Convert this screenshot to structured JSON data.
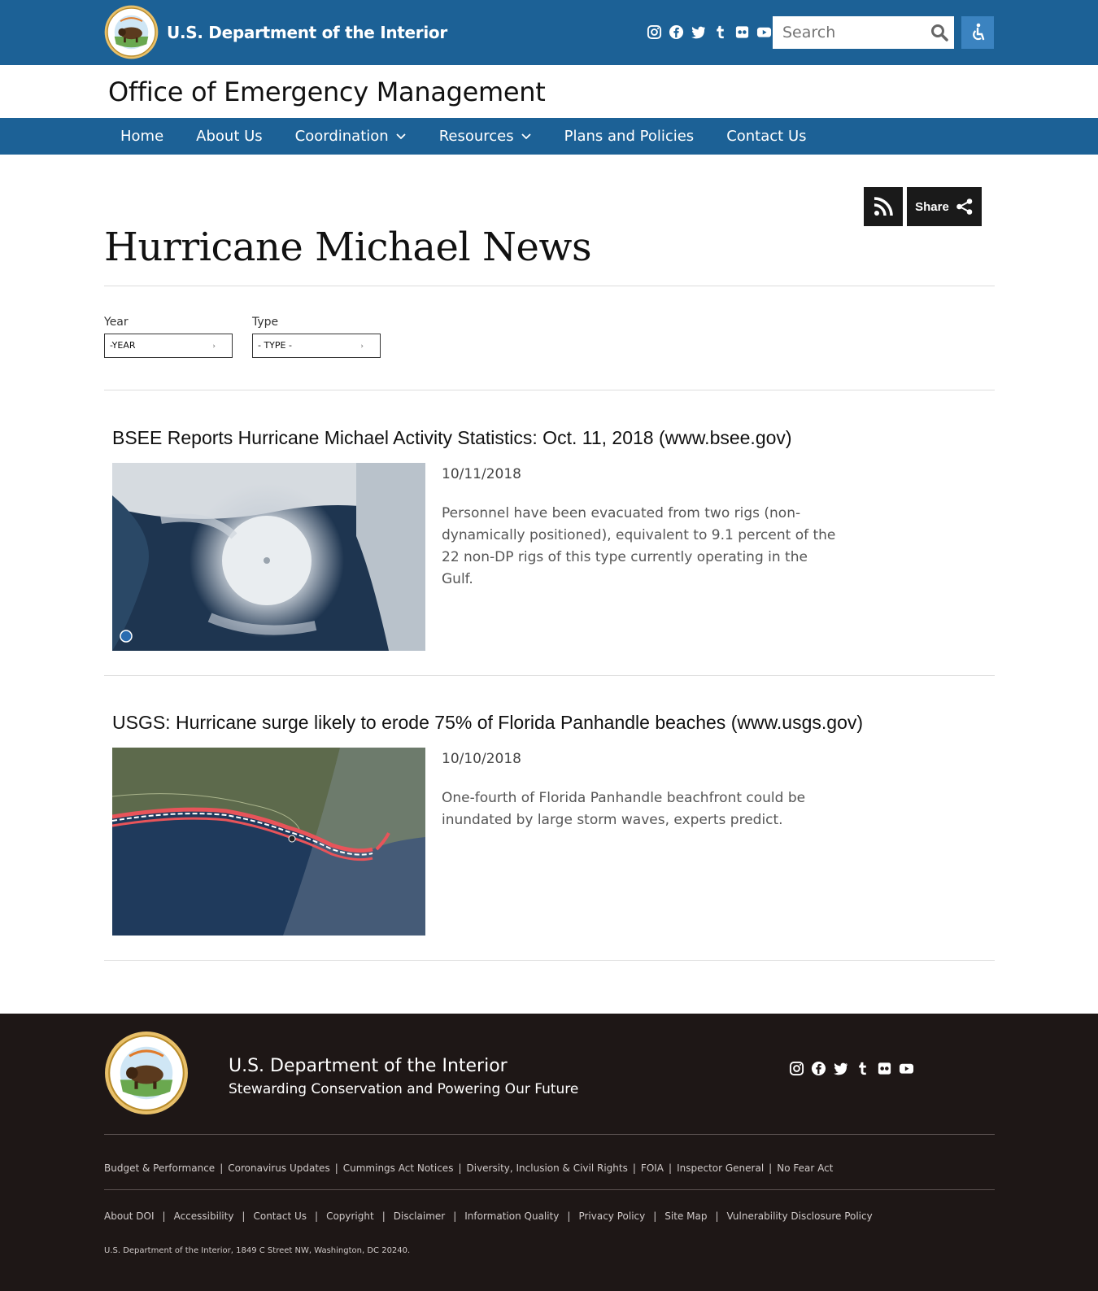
{
  "header": {
    "agency_name": "U.S. Department of the Interior",
    "search_placeholder": "Search",
    "social_icons": [
      "instagram-icon",
      "facebook-icon",
      "twitter-icon",
      "tumblr-icon",
      "flickr-icon",
      "youtube-icon"
    ],
    "colors": {
      "topbar": "#1c6196",
      "accessibility_button": "#3b83c0"
    }
  },
  "office": {
    "title": "Office of Emergency Management"
  },
  "nav": {
    "items": [
      {
        "label": "Home"
      },
      {
        "label": "About Us"
      },
      {
        "label": "Coordination"
      },
      {
        "label": "Resources"
      },
      {
        "label": "Plans and Policies"
      },
      {
        "label": "Contact Us"
      }
    ]
  },
  "actions": {
    "share_label": "Share"
  },
  "page": {
    "title": "Hurricane Michael News"
  },
  "filters": {
    "year_label": "Year",
    "year_value": "-YEAR",
    "type_label": "Type",
    "type_value": "- TYPE -"
  },
  "news": [
    {
      "title": "BSEE Reports Hurricane Michael Activity Statistics: Oct. 11, 2018 (www.bsee.gov)",
      "date": "10/11/2018",
      "summary": "Personnel have been evacuated from two rigs (non-dynamically positioned), equivalent to 9.1 percent of the 22 non-DP rigs of this type currently operating in the Gulf."
    },
    {
      "title": "USGS: Hurricane surge likely to erode 75% of Florida Panhandle beaches (www.usgs.gov)",
      "date": "10/10/2018",
      "summary": "One-fourth of Florida Panhandle beachfront could be inundated by large storm waves, experts predict."
    }
  ],
  "footer": {
    "name": "U.S. Department of the Interior",
    "tagline": "Stewarding Conservation and Powering Our Future",
    "links_row1": [
      "Budget & Performance",
      "Coronavirus Updates",
      "Cummings Act Notices",
      "Diversity, Inclusion & Civil Rights",
      "FOIA",
      "Inspector General",
      "No Fear Act"
    ],
    "links_row2": [
      "About DOI",
      "Accessibility",
      "Contact Us",
      "Copyright",
      "Disclaimer",
      "Information Quality",
      "Privacy Policy",
      "Site Map",
      "Vulnerability Disclosure Policy"
    ],
    "address": "U.S. Department of the Interior, 1849 C Street NW, Washington, DC 20240.",
    "colors": {
      "background": "#1e1716"
    }
  }
}
